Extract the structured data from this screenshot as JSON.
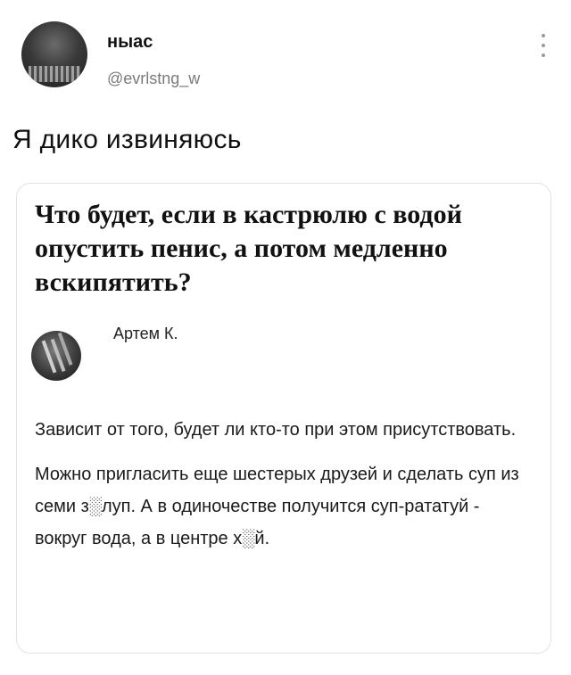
{
  "tweet": {
    "display_name": "ныас",
    "handle": "@evrlstng_w",
    "text": "Я дико извиняюсь",
    "more_icon": "more-vertical-icon"
  },
  "card": {
    "title": "Что будет, если в кастрюлю с водой опустить пенис, а потом медленно вскипятить?",
    "author": "Артем К.",
    "paragraphs": [
      "Зависит от того, будет ли кто-то при этом присутствовать.",
      "Можно пригласить еще шестерых друзей и сделать суп из семи з░луп. А в одиночестве получится суп-рататуй - вокруг вода, а в центре х░й."
    ]
  }
}
